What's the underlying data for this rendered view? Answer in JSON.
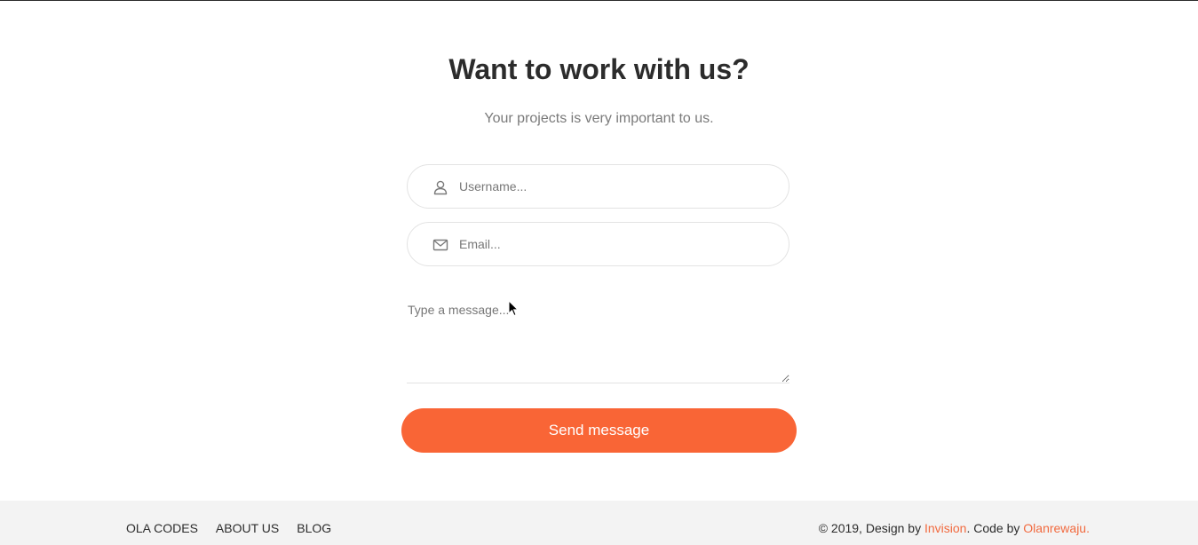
{
  "header": {
    "title": "Want to work with us?",
    "subtitle": "Your projects is very important to us."
  },
  "form": {
    "username": {
      "placeholder": "Username...",
      "icon": "user-icon"
    },
    "email": {
      "placeholder": "Email...",
      "icon": "envelope-icon"
    },
    "message": {
      "placeholder": "Type a message..."
    },
    "submit_label": "Send message"
  },
  "footer": {
    "nav": [
      "OLA CODES",
      "ABOUT US",
      "BLOG"
    ],
    "copyright_prefix": "© 2019, Design by",
    "design_link": "Invision",
    "code_text": ". Code by",
    "code_link": "Olanrewaju",
    "suffix": "."
  },
  "colors": {
    "accent": "#f96536",
    "link": "#f26a3f",
    "footer_bg": "#f3f3f3",
    "title": "#2c2c2c"
  }
}
